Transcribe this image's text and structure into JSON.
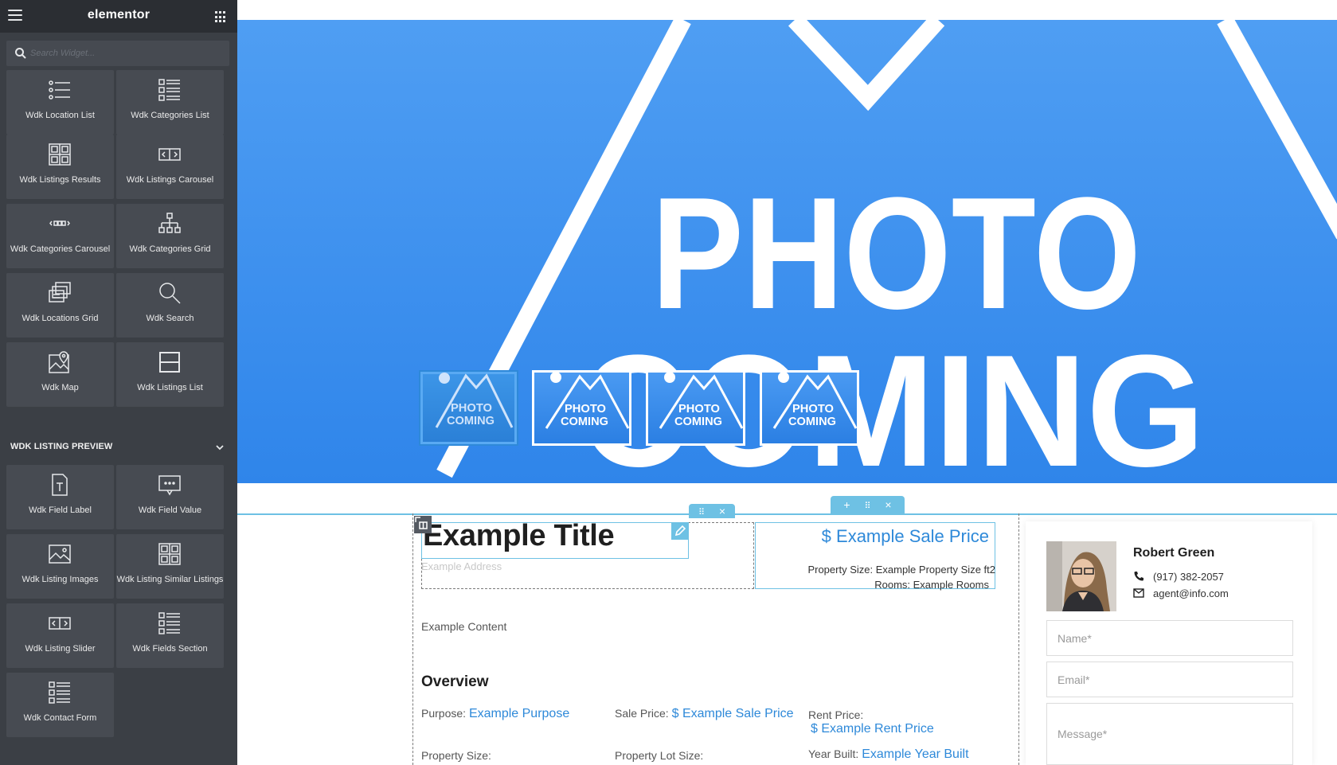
{
  "editor": {
    "brand": "elementor",
    "search_placeholder": "Search Widget..."
  },
  "widgets": [
    {
      "label": "Wdk Location List",
      "icon": "location-list-icon"
    },
    {
      "label": "Wdk Categories List",
      "icon": "categories-list-icon"
    },
    {
      "label": "Wdk Listings Results",
      "icon": "listings-results-icon"
    },
    {
      "label": "Wdk Listings Carousel",
      "icon": "listings-carousel-icon"
    },
    {
      "label": "Wdk Categories Carousel",
      "icon": "categories-carousel-icon"
    },
    {
      "label": "Wdk Categories Grid",
      "icon": "categories-grid-icon"
    },
    {
      "label": "Wdk Locations Grid",
      "icon": "locations-grid-icon"
    },
    {
      "label": "Wdk Search",
      "icon": "search-icon"
    },
    {
      "label": "Wdk Map",
      "icon": "map-icon"
    },
    {
      "label": "Wdk Listings List",
      "icon": "listings-list-icon"
    }
  ],
  "section": {
    "title": "WDK LISTING PREVIEW",
    "widgets": [
      {
        "label": "Wdk Field Label",
        "icon": "field-label-icon"
      },
      {
        "label": "Wdk Field Value",
        "icon": "field-value-icon"
      },
      {
        "label": "Wdk Listing Images",
        "icon": "listing-images-icon"
      },
      {
        "label": "Wdk Listing Similar Listings",
        "icon": "similar-listings-icon"
      },
      {
        "label": "Wdk Listing Slider",
        "icon": "listing-slider-icon"
      },
      {
        "label": "Wdk Fields Section",
        "icon": "fields-section-icon"
      },
      {
        "label": "Wdk Contact Form",
        "icon": "contact-form-icon"
      }
    ]
  },
  "hero": {
    "placeholder_line1": "PHOTO",
    "placeholder_line2": "COMING",
    "thumb_line1": "PHOTO",
    "thumb_line2": "COMING",
    "thumb_count": 4
  },
  "listing": {
    "title": "Example Title",
    "address": "Example Address",
    "sale_price": "$ Example Sale Price",
    "property_size_text": "Property Size: Example Property Size ft2",
    "rooms_text": "Rooms: Example Rooms",
    "content": "Example Content",
    "overview_heading": "Overview",
    "fields": {
      "purpose_label": "Purpose:",
      "purpose_value": "Example Purpose",
      "sale_price_label": "Sale Price:",
      "sale_price_value": "$ Example Sale Price",
      "rent_price_label": "Rent Price:",
      "rent_price_value": "$ Example Rent Price",
      "property_size_label": "Property Size:",
      "lot_size_label": "Property Lot Size:",
      "year_built_label": "Year Built:",
      "year_built_value": "Example Year Built"
    }
  },
  "agent": {
    "name": "Robert Green",
    "phone": "(917) 382-2057",
    "email": "agent@info.com",
    "name_placeholder": "Name*",
    "email_placeholder": "Email*",
    "message_placeholder": "Message*"
  },
  "colors": {
    "accent": "#6ec1e4",
    "link": "#2e89d9",
    "sidebar_bg": "#3b3f45",
    "hero_blue": "#4a9af2"
  }
}
